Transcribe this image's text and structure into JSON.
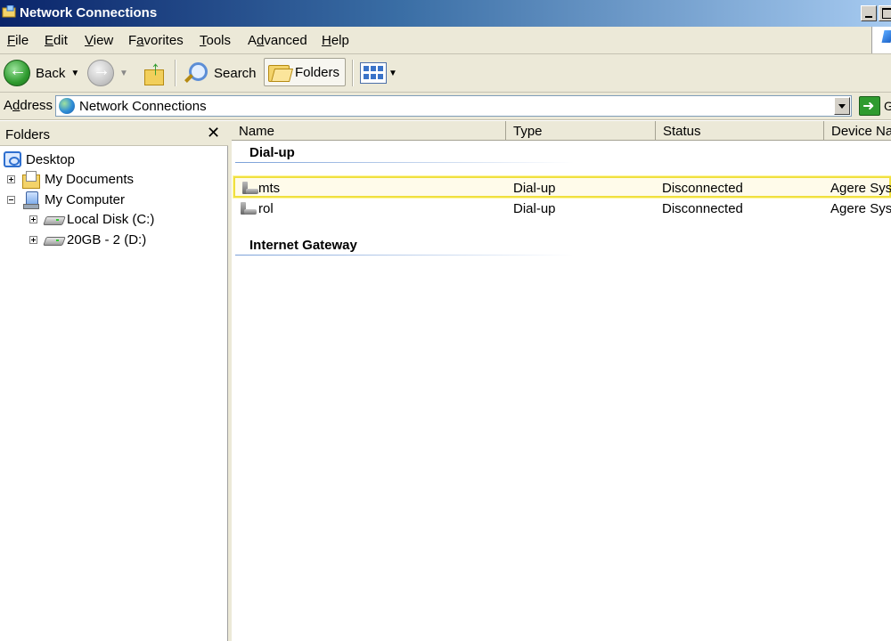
{
  "window": {
    "title": "Network Connections"
  },
  "menu": [
    {
      "label": "File",
      "u": "F",
      "rest": "ile"
    },
    {
      "label": "Edit",
      "u": "E",
      "rest": "dit"
    },
    {
      "label": "View",
      "u": "V",
      "rest": "iew"
    },
    {
      "label": "Favorites",
      "u": "",
      "pre": "F",
      "u2": "a",
      "rest": "vorites"
    },
    {
      "label": "Tools",
      "u": "T",
      "rest": "ools"
    },
    {
      "label": "Advanced",
      "u": "",
      "pre": "A",
      "u2": "d",
      "rest": "vanced"
    },
    {
      "label": "Help",
      "u": "H",
      "rest": "elp"
    }
  ],
  "toolbar": {
    "back_label": "Back",
    "search_label": "Search",
    "folders_label": "Folders"
  },
  "address": {
    "label_u": "d",
    "label_pre": "A",
    "label_rest": "dress",
    "value": "Network Connections",
    "go_label": "Go"
  },
  "folders_pane": {
    "title": "Folders",
    "close_glyph": "✕",
    "tree": {
      "desktop": "Desktop",
      "my_documents": "My Documents",
      "my_computer": "My Computer",
      "local_disk": "Local Disk (C:)",
      "drive_d": "20GB - 2 (D:)"
    }
  },
  "list": {
    "columns": [
      "Name",
      "Type",
      "Status",
      "Device Name"
    ],
    "groups": [
      {
        "title": "Dial-up",
        "rows": [
          {
            "name": "mts",
            "type": "Dial-up",
            "status": "Disconnected",
            "device": "Agere Systems"
          },
          {
            "name": "rol",
            "type": "Dial-up",
            "status": "Disconnected",
            "device": "Agere Systems"
          }
        ]
      },
      {
        "title": "Internet Gateway",
        "rows": []
      }
    ]
  }
}
